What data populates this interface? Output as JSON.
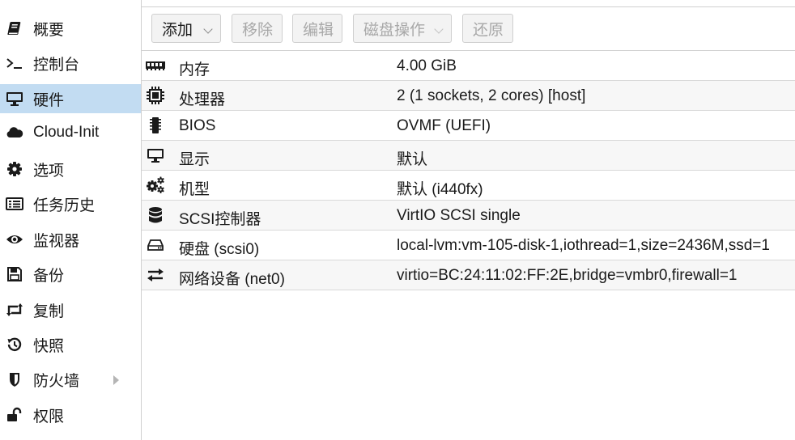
{
  "sidebar": {
    "items": [
      {
        "label": "概要",
        "icon": "book-icon",
        "active": false
      },
      {
        "label": "控制台",
        "icon": "terminal-icon",
        "active": false
      },
      {
        "label": "硬件",
        "icon": "desktop-icon",
        "active": true
      },
      {
        "label": "Cloud-Init",
        "icon": "cloud-icon",
        "active": false
      },
      {
        "label": "选项",
        "icon": "gear-icon",
        "active": false
      },
      {
        "label": "任务历史",
        "icon": "list-icon",
        "active": false
      },
      {
        "label": "监视器",
        "icon": "eye-icon",
        "active": false
      },
      {
        "label": "备份",
        "icon": "floppy-icon",
        "active": false
      },
      {
        "label": "复制",
        "icon": "retweet-icon",
        "active": false
      },
      {
        "label": "快照",
        "icon": "history-icon",
        "active": false
      },
      {
        "label": "防火墙",
        "icon": "shield-icon",
        "active": false
      },
      {
        "label": "权限",
        "icon": "unlock-icon",
        "active": false
      }
    ]
  },
  "toolbar": {
    "add_label": "添加",
    "remove_label": "移除",
    "edit_label": "编辑",
    "disk_action_label": "磁盘操作",
    "revert_label": "还原"
  },
  "hardware": {
    "rows": [
      {
        "name": "内存",
        "value": "4.00 GiB",
        "icon": "memory-icon"
      },
      {
        "name": "处理器",
        "value": "2 (1 sockets, 2 cores) [host]",
        "icon": "cpu-icon"
      },
      {
        "name": "BIOS",
        "value": "OVMF (UEFI)",
        "icon": "microchip-icon"
      },
      {
        "name": "显示",
        "value": "默认",
        "icon": "desktop-icon"
      },
      {
        "name": "机型",
        "value": "默认 (i440fx)",
        "icon": "cogs-icon"
      },
      {
        "name": "SCSI控制器",
        "value": "VirtIO SCSI single",
        "icon": "database-icon"
      },
      {
        "name": "硬盘 (scsi0)",
        "value": "local-lvm:vm-105-disk-1,iothread=1,size=2436M,ssd=1",
        "icon": "hdd-icon"
      },
      {
        "name": "网络设备 (net0)",
        "value": "virtio=BC:24:11:02:FF:2E,bridge=vmbr0,firewall=1",
        "icon": "exchange-icon"
      }
    ]
  },
  "colors": {
    "active_background": "#c2dcf2",
    "alt_row_background": "#f7f7f7",
    "border": "#d0d0d0"
  }
}
